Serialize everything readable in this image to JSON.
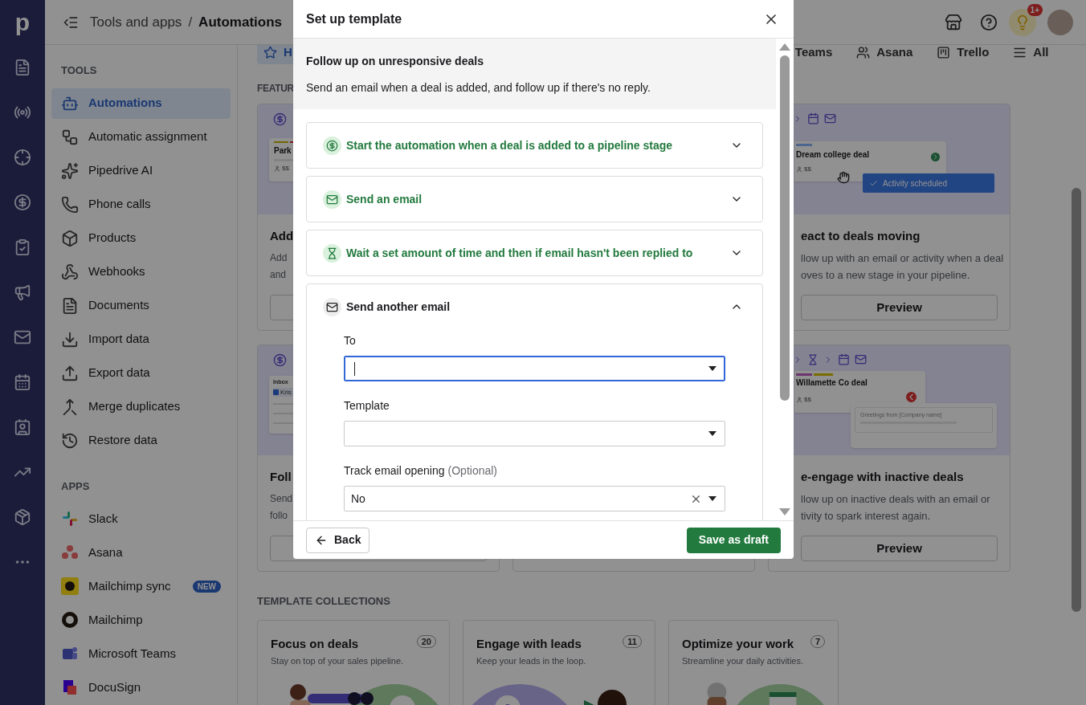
{
  "rail": {
    "logo": "p"
  },
  "header": {
    "breadcrumb": [
      {
        "label": "Tools and apps",
        "current": false
      },
      {
        "label": "Automations",
        "current": true
      }
    ],
    "separator": "/",
    "badge": "1+"
  },
  "sidebar": {
    "sections": [
      {
        "title": "TOOLS",
        "items": [
          {
            "label": "Automations",
            "selected": true
          },
          {
            "label": "Automatic assignment",
            "selected": false
          },
          {
            "label": "Pipedrive AI",
            "selected": false
          },
          {
            "label": "Phone calls",
            "selected": false
          },
          {
            "label": "Products",
            "selected": false
          },
          {
            "label": "Webhooks",
            "selected": false
          },
          {
            "label": "Documents",
            "selected": false
          },
          {
            "label": "Import data",
            "selected": false
          },
          {
            "label": "Export data",
            "selected": false
          },
          {
            "label": "Merge duplicates",
            "selected": false
          },
          {
            "label": "Restore data",
            "selected": false
          }
        ]
      },
      {
        "title": "APPS",
        "items": [
          {
            "label": "Slack",
            "selected": false
          },
          {
            "label": "Asana",
            "selected": false
          },
          {
            "label": "Mailchimp sync",
            "selected": false,
            "badge": "NEW"
          },
          {
            "label": "Mailchimp",
            "selected": false
          },
          {
            "label": "Microsoft Teams",
            "selected": false
          },
          {
            "label": "DocuSign",
            "selected": false
          }
        ]
      }
    ]
  },
  "filters": [
    {
      "label": "H",
      "selected": true
    },
    {
      "label": "Teams",
      "selected": false
    },
    {
      "label": "Asana",
      "selected": false
    },
    {
      "label": "Trello",
      "selected": false
    },
    {
      "label": "All",
      "selected": false
    }
  ],
  "featured": {
    "title": "FEATUR",
    "left_cards": [
      {
        "title": "Add",
        "description": [
          "Add",
          "and"
        ],
        "preview": {
          "kind": "deal",
          "deal": "Park",
          "amount": "$$"
        }
      },
      {
        "title": "Foll",
        "description": [
          "Send",
          "follo"
        ],
        "preview": {
          "kind": "inbox",
          "heading": "Inbox",
          "row": "Kris",
          "checked": true
        }
      }
    ],
    "right_cards": [
      {
        "title": "eact to deals moving",
        "description": [
          "llow up with an email or activity when a deal",
          "oves to a new stage in your pipeline."
        ],
        "button": "Preview",
        "preview": {
          "kind": "activity",
          "deal": "Dream college deal",
          "amount": "$$",
          "toast": "Activity scheduled"
        }
      },
      {
        "title": "e-engage with inactive deals",
        "description": [
          "llow up on inactive deals with an email or",
          "tivity to spark interest again."
        ],
        "button": "Preview",
        "preview": {
          "kind": "email",
          "deal": "Willamette Co deal",
          "amount": "$$",
          "greeting": "Greetings from [Company name]"
        }
      }
    ]
  },
  "collections": {
    "title": "TEMPLATE COLLECTIONS",
    "cards": [
      {
        "title": "Focus on deals",
        "count": "20",
        "description": "Stay on top of your sales pipeline.",
        "kind": "binoculars"
      },
      {
        "title": "Engage with leads",
        "count": "11",
        "description": "Keep your leads in the loop.",
        "kind": "target"
      },
      {
        "title": "Optimize your work",
        "count": "7",
        "description": "Streamline your daily activities.",
        "kind": "calendar"
      }
    ]
  },
  "modal": {
    "title": "Set up template",
    "intro": {
      "title": "Follow up on unresponsive deals",
      "description": "Send an email when a deal is added, and follow up if there's no reply."
    },
    "steps": [
      {
        "kind": "deal",
        "label": "Start the automation when a deal is added to a pipeline stage",
        "complete": true,
        "expanded": false
      },
      {
        "kind": "email",
        "label": "Send an email",
        "complete": true,
        "expanded": false
      },
      {
        "kind": "wait",
        "label": "Wait a set amount of time and then if email hasn't been replied to",
        "complete": true,
        "expanded": false
      },
      {
        "kind": "email",
        "label": "Send another email",
        "complete": false,
        "expanded": true
      }
    ],
    "fields": [
      {
        "label": "To",
        "focused": true,
        "clearable": false
      },
      {
        "label": "Template",
        "focused": false,
        "clearable": false
      },
      {
        "label": "Track email opening",
        "optional": "(Optional)",
        "value": "No",
        "focused": false,
        "clearable": true
      }
    ],
    "back": "Back",
    "save": "Save as draft"
  }
}
